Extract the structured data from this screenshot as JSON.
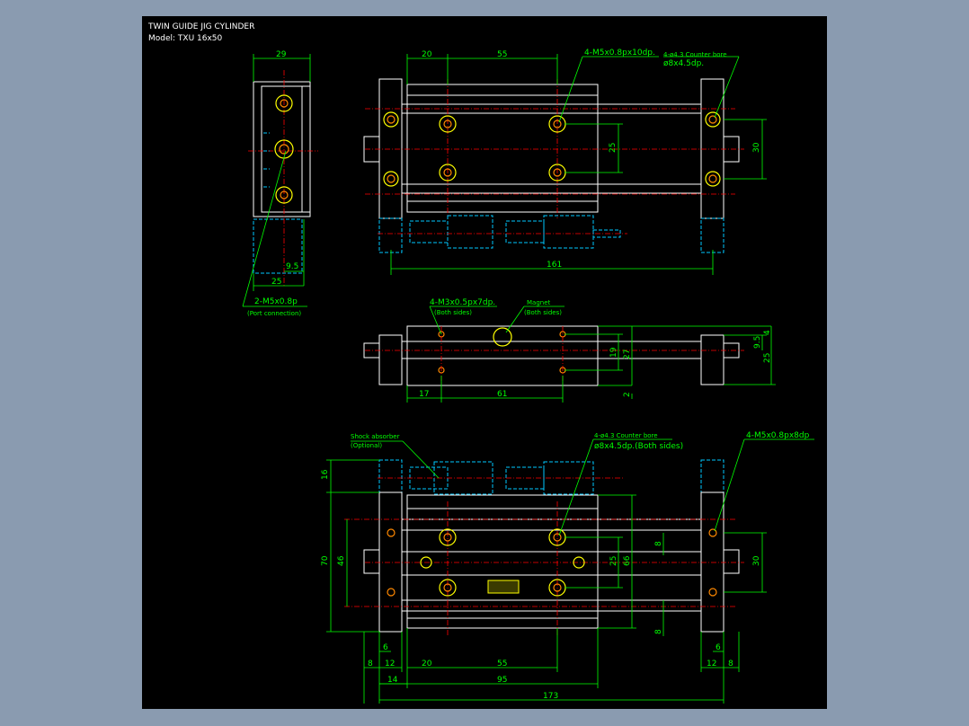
{
  "title": {
    "line1": "TWIN GUIDE JIG CYLINDER",
    "line2": "Model: TXU 16x50"
  },
  "dims": {
    "d29": "29",
    "d20_top": "20",
    "d55_top": "55",
    "d25_top": "25",
    "d30_top": "30",
    "d9_5_left": "9.5",
    "d25_left": "25",
    "d161": "161",
    "d17": "17",
    "d61": "61",
    "d19": "19",
    "d27": "27",
    "d9_5_mid": "9.5",
    "d4_mid": "4",
    "d25_mid": "25",
    "d2_mid": "2",
    "d16": "16",
    "d70": "70",
    "d46": "46",
    "d25_bot": "25",
    "d66": "66",
    "d8_a": "8",
    "d8_b": "8",
    "d30_bot": "30",
    "d6_l": "6",
    "d8_l": "8",
    "d12_l": "12",
    "d14": "14",
    "d20_bot": "20",
    "d55_bot": "55",
    "d95": "95",
    "d173": "173",
    "d12_r": "12",
    "d8_r": "8",
    "d6_r": "6"
  },
  "callouts": {
    "m5_top": "4-M5x0.8px10dp.",
    "cbore_top_1": "4-ø4.3 Counter bore",
    "cbore_top_2": "ø8x4.5dp.",
    "port_1": "2-M5x0.8p",
    "port_2": "(Port connection)",
    "m3_1": "4-M3x0.5px7dp.",
    "m3_2": "(Both sides)",
    "magnet_1": "Magnet",
    "magnet_2": "(Both sides)",
    "shock_1": "Shock absorber",
    "shock_2": "(Optional)",
    "cbore_bot_1": "4-ø4.3 Counter bore",
    "cbore_bot_2": "ø8x4.5dp.(Both sides)",
    "m5_bot": "4-M5x0.8px8dp"
  },
  "colors": {
    "background": "#000000",
    "outline": "#ffffff",
    "dimension": "#00ff00",
    "centerline": "#ff0000",
    "hidden": "#00c8ff",
    "hole": "#ffff00"
  }
}
